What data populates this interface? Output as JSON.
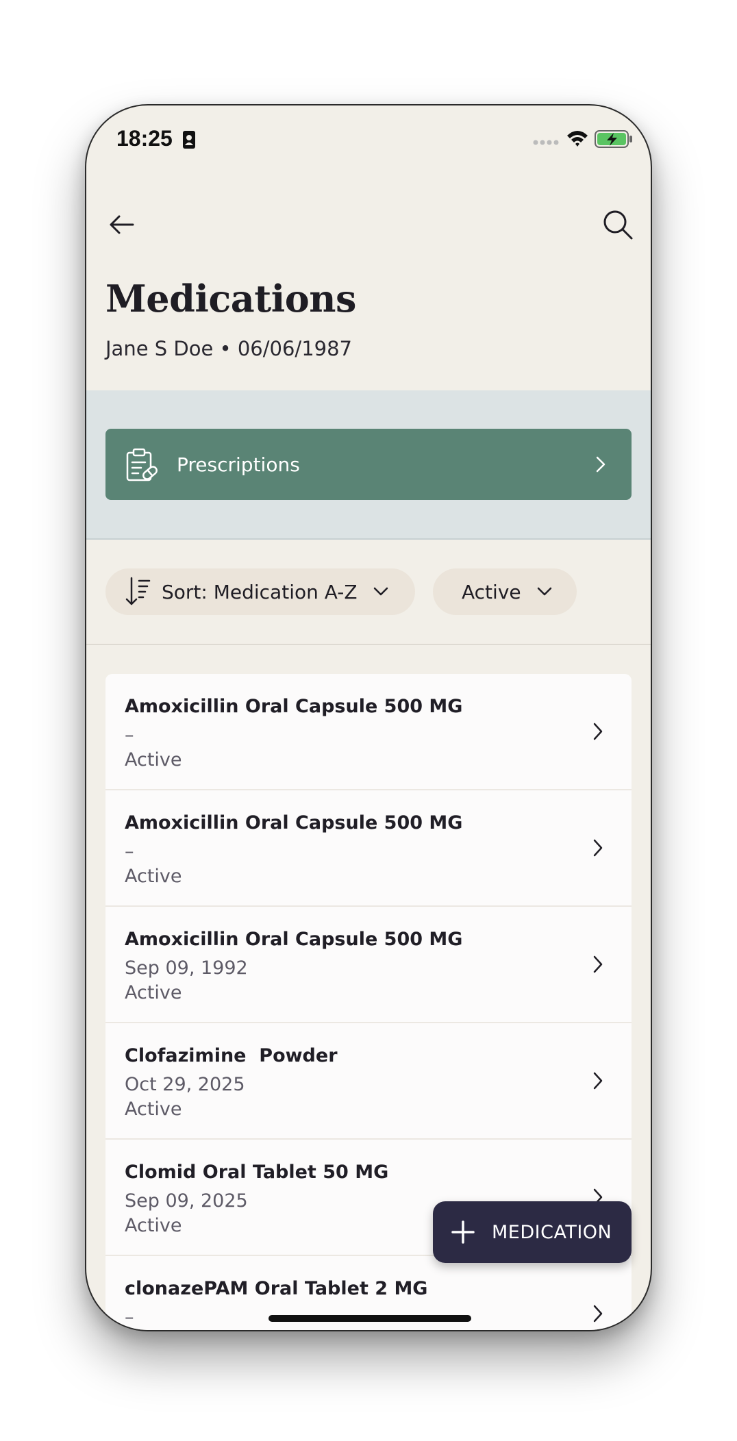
{
  "status_bar": {
    "time": "18:25"
  },
  "header": {
    "title": "Medications",
    "patient": "Jane S Doe • 06/06/1987"
  },
  "prescriptions": {
    "label": "Prescriptions"
  },
  "filters": {
    "sort_label": "Sort: Medication A-Z",
    "status_label": "Active"
  },
  "medications": [
    {
      "name": "Amoxicillin Oral Capsule 500 MG",
      "date": "–",
      "status": "Active"
    },
    {
      "name": "Amoxicillin Oral Capsule 500 MG",
      "date": "–",
      "status": "Active"
    },
    {
      "name": "Amoxicillin Oral Capsule 500 MG",
      "date": "Sep 09, 1992",
      "status": "Active"
    },
    {
      "name": "Clofazimine  Powder",
      "date": "Oct 29, 2025",
      "status": "Active"
    },
    {
      "name": "Clomid Oral Tablet 50 MG",
      "date": "Sep 09, 2025",
      "status": "Active"
    },
    {
      "name": "clonazePAM Oral Tablet 2 MG",
      "date": "–",
      "status": ""
    }
  ],
  "fab": {
    "label": "MEDICATION"
  },
  "colors": {
    "background": "#f2efe8",
    "prescriptions_button": "#5a8475",
    "band": "#dce3e4",
    "chip": "#ebe4da",
    "fab": "#2c2a44"
  }
}
